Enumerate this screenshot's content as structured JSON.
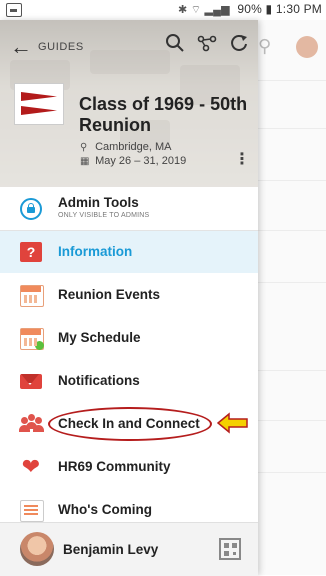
{
  "status_bar": {
    "battery": "90%",
    "time": "1:30 PM"
  },
  "nav": {
    "section_label": "GUIDES"
  },
  "event": {
    "title": "Class of 1969 - 50th Reunion",
    "location": "Cambridge, MA",
    "dates": "May 26 – 31, 2019"
  },
  "menu": {
    "items": [
      {
        "label": "Admin Tools",
        "sub": "ONLY VISIBLE TO ADMINS",
        "icon": "lock-icon"
      },
      {
        "label": "Information",
        "icon": "question-icon",
        "active": true
      },
      {
        "label": "Reunion Events",
        "icon": "calendar-icon"
      },
      {
        "label": "My Schedule",
        "icon": "schedule-icon"
      },
      {
        "label": "Notifications",
        "icon": "mail-icon"
      },
      {
        "label": "Check In and Connect",
        "icon": "people-icon"
      },
      {
        "label": "HR69 Community",
        "icon": "heart-icon"
      },
      {
        "label": "Who's Coming",
        "icon": "attendee-list-icon"
      }
    ]
  },
  "user": {
    "name": "Benjamin Levy"
  },
  "colors": {
    "accent": "#1a9ad6",
    "active_bg": "#e5f3fa",
    "icon_red": "#e0433c",
    "annotation": "#b51d1d",
    "arrow_fill": "#f5d000"
  }
}
